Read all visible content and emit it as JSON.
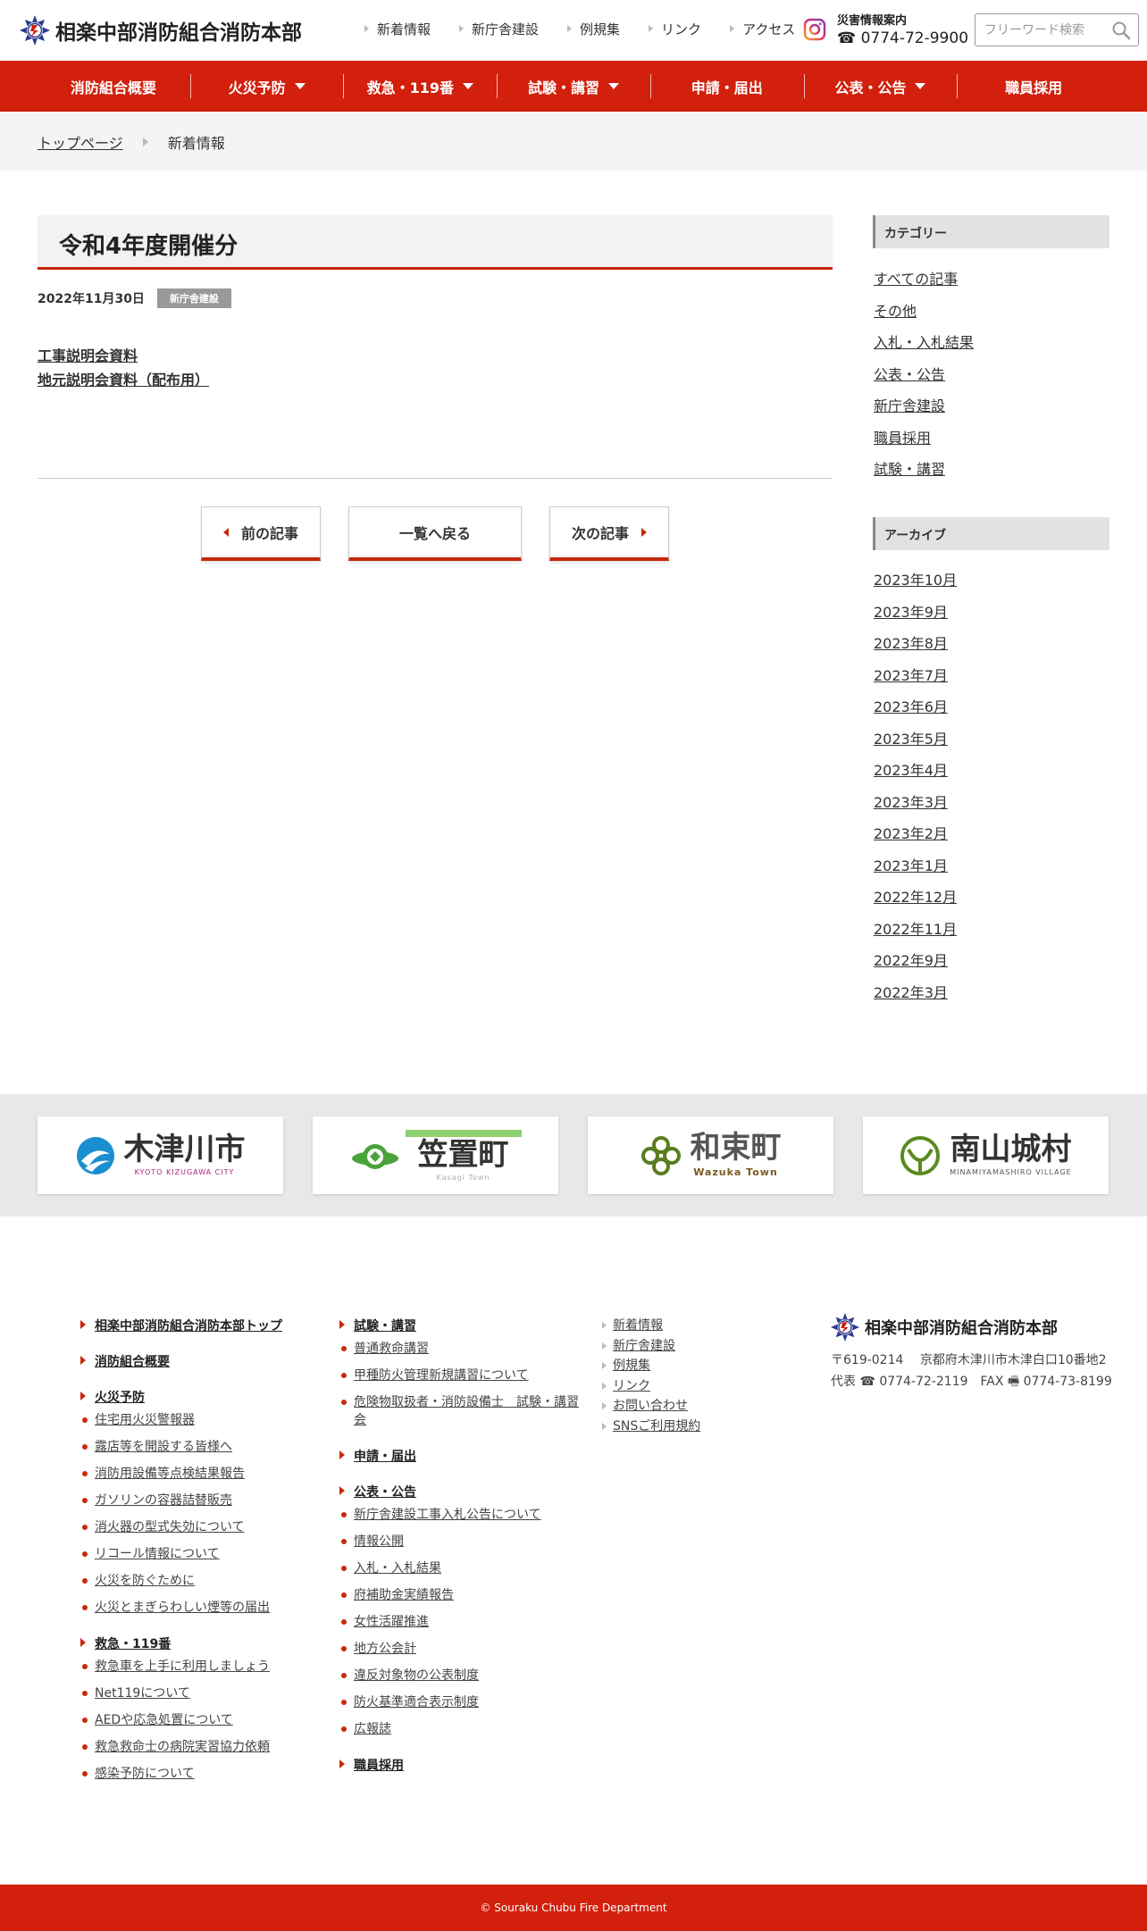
{
  "header": {
    "site_title": "相楽中部消防組合消防本部",
    "top_links": [
      "新着情報",
      "新庁舎建設",
      "例規集",
      "リンク",
      "アクセス"
    ],
    "disaster_label": "災害情報案内",
    "disaster_tel": "☎ 0774-72-9900",
    "search_placeholder": "フリーワード検索"
  },
  "nav": [
    {
      "label": "消防組合概要",
      "has_dropdown": false
    },
    {
      "label": "火災予防",
      "has_dropdown": true
    },
    {
      "label": "救急・119番",
      "has_dropdown": true
    },
    {
      "label": "試験・講習",
      "has_dropdown": true
    },
    {
      "label": "申請・届出",
      "has_dropdown": false
    },
    {
      "label": "公表・公告",
      "has_dropdown": true
    },
    {
      "label": "職員採用",
      "has_dropdown": false
    }
  ],
  "breadcrumb": {
    "home": "トップページ",
    "current": "新着情報"
  },
  "article": {
    "title": "令和4年度開催分",
    "date": "2022年11月30日",
    "category": "新庁舎建設",
    "links": [
      "工事説明会資料",
      "地元説明会資料（配布用）"
    ]
  },
  "pager": {
    "prev": "前の記事",
    "list": "一覧へ戻る",
    "next": "次の記事"
  },
  "sidebar": {
    "category_heading": "カテゴリー",
    "categories": [
      "すべての記事",
      "その他",
      "入札・入札結果",
      "公表・公告",
      "新庁舎建設",
      "職員採用",
      "試験・講習"
    ],
    "archive_heading": "アーカイブ",
    "archives": [
      "2023年10月",
      "2023年9月",
      "2023年8月",
      "2023年7月",
      "2023年6月",
      "2023年5月",
      "2023年4月",
      "2023年3月",
      "2023年2月",
      "2023年1月",
      "2022年12月",
      "2022年11月",
      "2022年9月",
      "2022年3月"
    ]
  },
  "banners": [
    {
      "name": "木津川市",
      "sub": "KYOTO KIZUGAWA CITY"
    },
    {
      "name": "笠置町",
      "sub": "Kasagi Town"
    },
    {
      "name": "和束町",
      "sub": "Wazuka Town"
    },
    {
      "name": "南山城村",
      "sub": "MINAMIYAMASHIRO VILLAGE"
    }
  ],
  "footer": {
    "col1": {
      "top": "相楽中部消防組合消防本部トップ",
      "overview": "消防組合概要",
      "fire_prevention": "火災予防",
      "fire_items": [
        "住宅用火災警報器",
        "露店等を開設する皆様へ",
        "消防用設備等点検結果報告",
        "ガソリンの容器詰替販売",
        "消火器の型式失効について",
        "リコール情報について",
        "火災を防ぐために",
        "火災とまぎらわしい煙等の届出"
      ],
      "emergency": "救急・119番",
      "emergency_items": [
        "救急車を上手に利用しましょう",
        "Net119について",
        "AEDや応急処置について",
        "救急救命士の病院実習協力依頼",
        "感染予防について"
      ]
    },
    "col2": {
      "exam": "試験・講習",
      "exam_items": [
        "普通救命講習",
        "甲種防火管理新規講習について",
        "危険物取扱者・消防設備士　試験・講習会"
      ],
      "apply": "申請・届出",
      "public": "公表・公告",
      "public_items": [
        "新庁舎建設工事入札公告について",
        "情報公開",
        "入札・入札結果",
        "府補助金実績報告",
        "女性活躍推進",
        "地方公会計",
        "違反対象物の公表制度",
        "防火基準適合表示制度",
        "広報誌"
      ],
      "recruit": "職員採用"
    },
    "col3": [
      "新着情報",
      "新庁舎建設",
      "例規集",
      "リンク",
      "お問い合わせ",
      "SNSご利用規約"
    ],
    "org_name": "相楽中部消防組合消防本部",
    "address": "〒619-0214　 京都府木津川市木津白口10番地2",
    "tel_line": "代表 ☎ 0774-72-2119　FAX 🖷 0774-73-8199",
    "copyright": "© Souraku Chubu Fire Department"
  },
  "colors": {
    "brand_red": "#d2200c",
    "accent_red": "#c8280c"
  }
}
